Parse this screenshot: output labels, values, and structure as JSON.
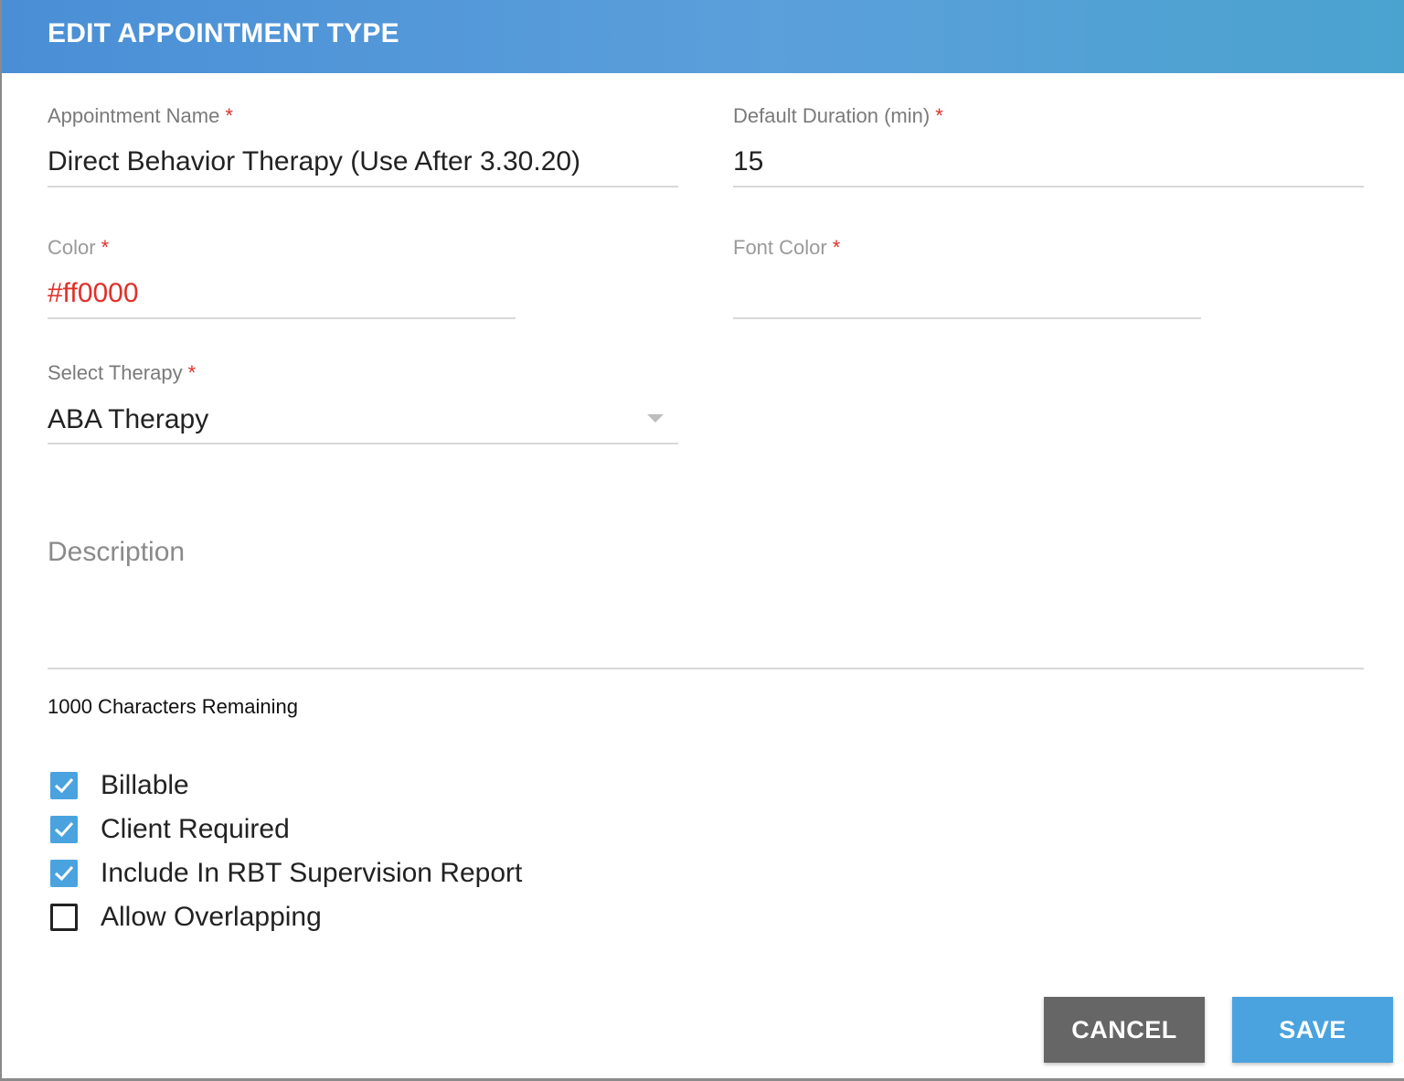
{
  "dialog": {
    "title": "EDIT APPOINTMENT TYPE"
  },
  "form": {
    "appointment_name": {
      "label": "Appointment Name",
      "required": "*",
      "value": "Direct Behavior Therapy (Use After 3.30.20)"
    },
    "default_duration": {
      "label": "Default Duration (min)",
      "required": "*",
      "value": "15"
    },
    "color": {
      "label": "Color",
      "required": "*",
      "value": "#ff0000",
      "value_color": "#e0302a"
    },
    "font_color": {
      "label": "Font Color",
      "required": "*",
      "value": ""
    },
    "select_therapy": {
      "label": "Select Therapy",
      "required": "*",
      "value": "ABA Therapy",
      "icon": "chevron-down-icon"
    },
    "description": {
      "label": "Description",
      "value": "",
      "remaining_text": "1000 Characters Remaining"
    }
  },
  "checkboxes": [
    {
      "label": "Billable",
      "checked": true
    },
    {
      "label": "Client Required",
      "checked": true
    },
    {
      "label": "Include In RBT Supervision Report",
      "checked": true
    },
    {
      "label": "Allow Overlapping",
      "checked": false
    }
  ],
  "actions": {
    "cancel_label": "CANCEL",
    "save_label": "SAVE"
  },
  "colors": {
    "header": "#4a8fd6",
    "accent": "#4aa3de",
    "cancel": "#666666",
    "required": "#e0302a"
  }
}
